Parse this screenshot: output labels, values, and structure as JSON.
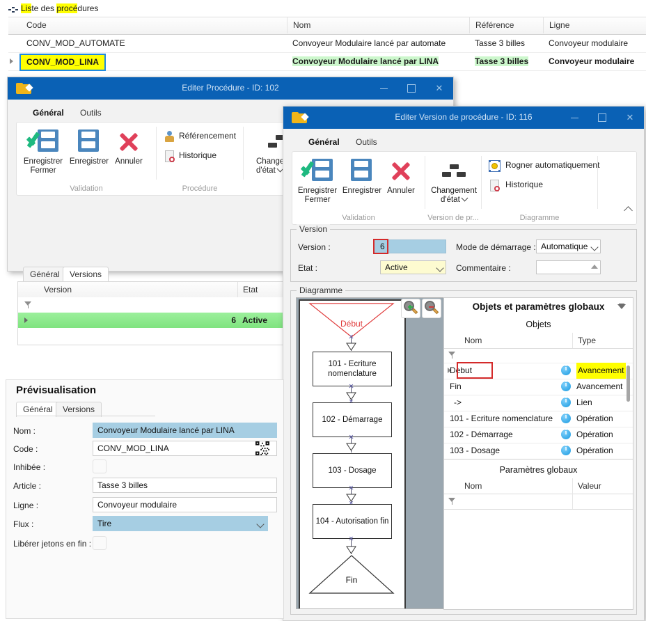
{
  "breadcrumb": {
    "label": "Liste des procédures",
    "highlight_parts": [
      "Lis",
      "procé"
    ]
  },
  "procedures_grid": {
    "columns": [
      "Code",
      "Nom",
      "Référence principale",
      "Ligne"
    ],
    "rows": [
      {
        "code": "CONV_MOD_AUTOMATE",
        "nom": "Convoyeur Modulaire lancé par automate",
        "reference": "Tasse 3 billes",
        "ligne": "Convoyeur modulaire",
        "selected": false
      },
      {
        "code": "CONV_MOD_LINA",
        "nom": "Convoyeur Modulaire lancé par LINA",
        "reference": "Tasse 3 billes",
        "ligne": "Convoyeur modulaire",
        "selected": true
      }
    ]
  },
  "window_procedure": {
    "title": "Editer Procédure - ID: 102",
    "ribbon_tabs": [
      {
        "label": "Général",
        "active": true
      },
      {
        "label": "Outils",
        "active": false
      }
    ],
    "buttons": {
      "save_close": "Enregistrer\nFermer",
      "save_close_line1": "Enregistrer",
      "save_close_line2": "Fermer",
      "save": "Enregistrer",
      "cancel": "Annuler",
      "referencement": "Référencement",
      "historique": "Historique",
      "changement_line1": "Changement",
      "changement_line2": "d'état"
    },
    "groups": {
      "validation": "Validation",
      "procedure": "Procédure"
    },
    "inner_tabs": [
      {
        "label": "Général",
        "active": false
      },
      {
        "label": "Versions",
        "active": true
      }
    ],
    "versions_grid": {
      "columns": [
        "Version",
        "Etat"
      ],
      "rows": [
        {
          "version": "6",
          "etat": "Active"
        }
      ]
    }
  },
  "window_version": {
    "title": "Editer Version de procédure - ID: 116",
    "ribbon_tabs": [
      {
        "label": "Général",
        "active": true
      },
      {
        "label": "Outils",
        "active": false
      }
    ],
    "buttons": {
      "save_close_line1": "Enregistrer",
      "save_close_line2": "Fermer",
      "save": "Enregistrer",
      "cancel": "Annuler",
      "changement_line1": "Changement",
      "changement_line2": "d'état",
      "rogner": "Rogner automatiquement",
      "historique": "Historique"
    },
    "groups": {
      "validation": "Validation",
      "version": "Version de pr...",
      "diagramme": "Diagramme"
    },
    "version_group": {
      "caption": "Version",
      "version_label": "Version :",
      "version_value": "6",
      "etat_label": "Etat :",
      "etat_value": "Active",
      "mode_label": "Mode de démarrage :",
      "mode_value": "Automatique",
      "commentaire_label": "Commentaire :",
      "commentaire_value": ""
    },
    "diagram_group": {
      "caption": "Diagramme",
      "zoom_in": "zoom-in-icon",
      "zoom_out": "zoom-out-icon",
      "nodes": [
        {
          "label": "Début",
          "shape": "start-triangle"
        },
        {
          "label": "101 - Ecriture nomenclature",
          "shape": "rect"
        },
        {
          "label": "102 - Démarrage",
          "shape": "rect"
        },
        {
          "label": "103 - Dosage",
          "shape": "rect"
        },
        {
          "label": "104 - Autorisation fin",
          "shape": "rect"
        },
        {
          "label": "Fin",
          "shape": "end-triangle"
        }
      ]
    },
    "objects_panel": {
      "title": "Objets et paramètres globaux",
      "objects_subtitle": "Objets",
      "objects_columns": [
        "Nom",
        "Type"
      ],
      "objects_rows": [
        {
          "nom": "Debut",
          "type": "Avancement",
          "highlighted": true
        },
        {
          "nom": "Fin",
          "type": "Avancement",
          "highlighted": false
        },
        {
          "nom": "->",
          "type": "Lien",
          "highlighted": false
        },
        {
          "nom": "101 - Ecriture nomenclature",
          "type": "Opération",
          "highlighted": false
        },
        {
          "nom": "102 - Démarrage",
          "type": "Opération",
          "highlighted": false
        },
        {
          "nom": "103 - Dosage",
          "type": "Opération",
          "highlighted": false
        }
      ],
      "params_subtitle": "Paramètres globaux",
      "params_columns": [
        "Nom",
        "Valeur"
      ],
      "params_rows": []
    }
  },
  "preview": {
    "title": "Prévisualisation",
    "tabs": [
      {
        "label": "Général",
        "active": true
      },
      {
        "label": "Versions",
        "active": false
      }
    ],
    "fields": [
      {
        "label": "Nom :",
        "value": "Convoyeur Modulaire lancé par LINA",
        "kind": "text-blue"
      },
      {
        "label": "Code :",
        "value": "CONV_MOD_LINA",
        "kind": "text"
      },
      {
        "label": "Inhibée :",
        "value": "",
        "kind": "checkbox"
      },
      {
        "label": "Article :",
        "value": "Tasse 3 billes",
        "kind": "text"
      },
      {
        "label": "Ligne :",
        "value": "Convoyeur modulaire",
        "kind": "text"
      },
      {
        "label": "Flux :",
        "value": "Tire",
        "kind": "combo-blue"
      },
      {
        "label": "Libérer jetons en fin :",
        "value": "",
        "kind": "checkbox"
      }
    ]
  },
  "colors": {
    "title_bar": "#0a61b5",
    "accent_blue": "#1f8ae0",
    "highlight_yellow": "#ffff00",
    "row_green": "#90ee90",
    "red_marker": "#d42a2a",
    "field_blue": "#a6cee3"
  }
}
